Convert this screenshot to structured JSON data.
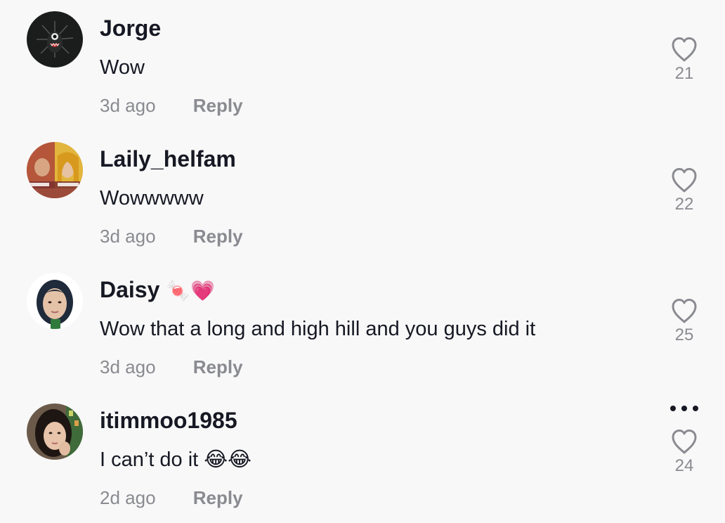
{
  "comments": [
    {
      "username": "Jorge",
      "username_emoji": "",
      "text": "Wow",
      "time": "3d ago",
      "reply_label": "Reply",
      "likes": "21",
      "avatar_icon": "monster-avatar"
    },
    {
      "username": "Laily_helfam",
      "username_emoji": "",
      "text": "Wowwwww",
      "time": "3d ago",
      "reply_label": "Reply",
      "likes": "22",
      "avatar_icon": "photo-avatar"
    },
    {
      "username": "Daisy",
      "username_emoji": "🍬💗",
      "text": "Wow that a long and high hill and you guys did it",
      "time": "3d ago",
      "reply_label": "Reply",
      "likes": "25",
      "avatar_icon": "photo-avatar"
    },
    {
      "username": "itimmoo1985",
      "username_emoji": "",
      "text": "I can’t do it 😂😂",
      "time": "2d ago",
      "reply_label": "Reply",
      "likes": "24",
      "avatar_icon": "photo-avatar"
    }
  ],
  "icons": {
    "like": "heart-outline-icon",
    "more": "more-options-icon"
  },
  "colors": {
    "background": "#f8f8f8",
    "text_primary": "#161823",
    "text_secondary": "#8a8b91"
  }
}
